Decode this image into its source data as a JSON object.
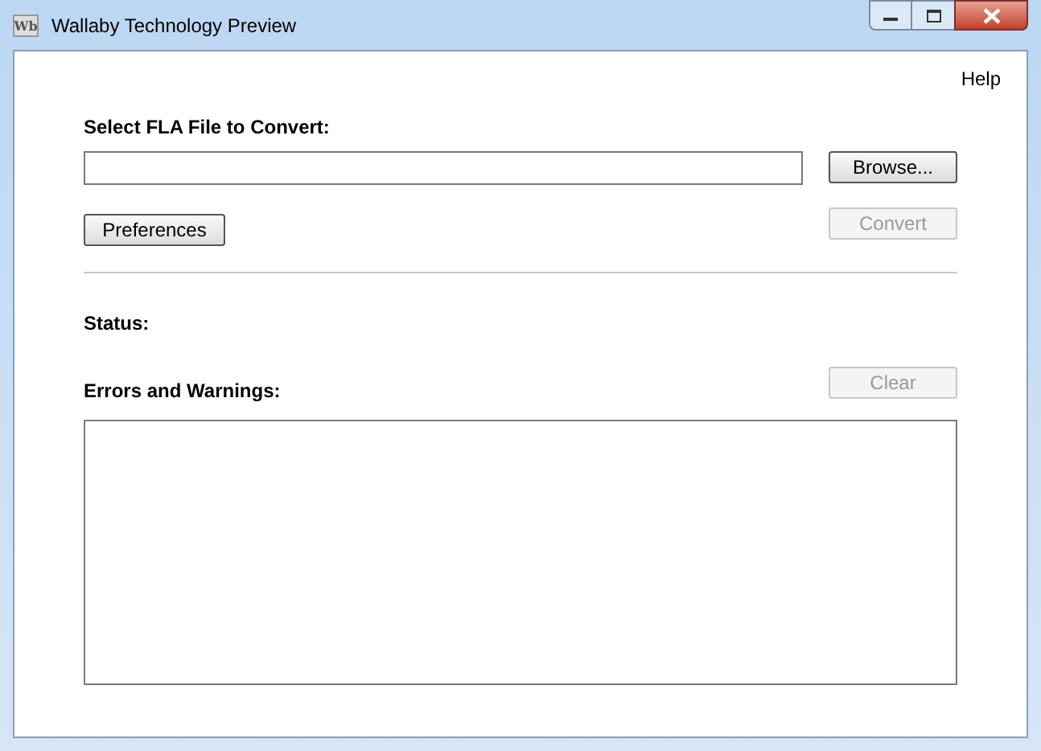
{
  "window": {
    "title": "Wallaby Technology Preview",
    "icon_text": "Wb"
  },
  "menu": {
    "help": "Help"
  },
  "file": {
    "label": "Select FLA File to Convert:"
  },
  "buttons": [
    {
      "label": "Browse...",
      "disabled": false
    },
    {
      "label": "Preferences",
      "disabled": false
    },
    {
      "label": "Convert",
      "disabled": true
    },
    {
      "label": "Clear",
      "disabled": true
    }
  ],
  "status": {
    "label": "Status:"
  },
  "errors": {
    "label": "Errors and Warnings:"
  }
}
